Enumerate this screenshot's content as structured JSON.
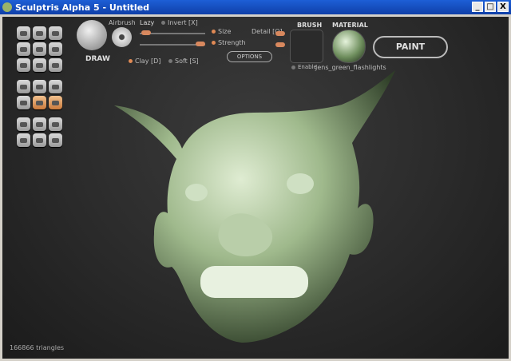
{
  "window": {
    "title": "Sculptris Alpha 5 - Untitled",
    "buttons": [
      "_",
      "□",
      "X"
    ]
  },
  "tool": {
    "name": "DRAW",
    "airbrush_label": "Airbrush",
    "lazy_label": "Lazy",
    "invert_label": "Invert [X]",
    "size_label": "Size",
    "detail_label": "Detail [Q]",
    "strength_label": "Strength",
    "options_label": "OPTIONS",
    "clay_label": "Clay [D]",
    "soft_label": "Soft [S]"
  },
  "brush": {
    "header": "BRUSH",
    "enable_label": "Enable"
  },
  "material": {
    "header": "MATERIAL",
    "name": "Jens_green_flashlights"
  },
  "paint_label": "PAINT",
  "status": {
    "triangles": "166866 triangles"
  },
  "colors": {
    "titlebar": "#1552c4",
    "accent_orange": "#d8885e",
    "model_green": "#a9c49a"
  },
  "icons": [
    "draw-icon",
    "rotate-icon",
    "crop-icon",
    "grab-icon",
    "crease-icon",
    "pinch-icon",
    "inflate-icon",
    "flatten-icon",
    "smooth-icon",
    "symmetry-icon",
    "wireframe-icon",
    "grid-icon",
    "reduce-icon",
    "mirror-x-icon",
    "mirror-arrows-icon",
    "sphere-icon",
    "plane-icon",
    "group-icon",
    "home-icon",
    "save-icon",
    "open-icon"
  ]
}
